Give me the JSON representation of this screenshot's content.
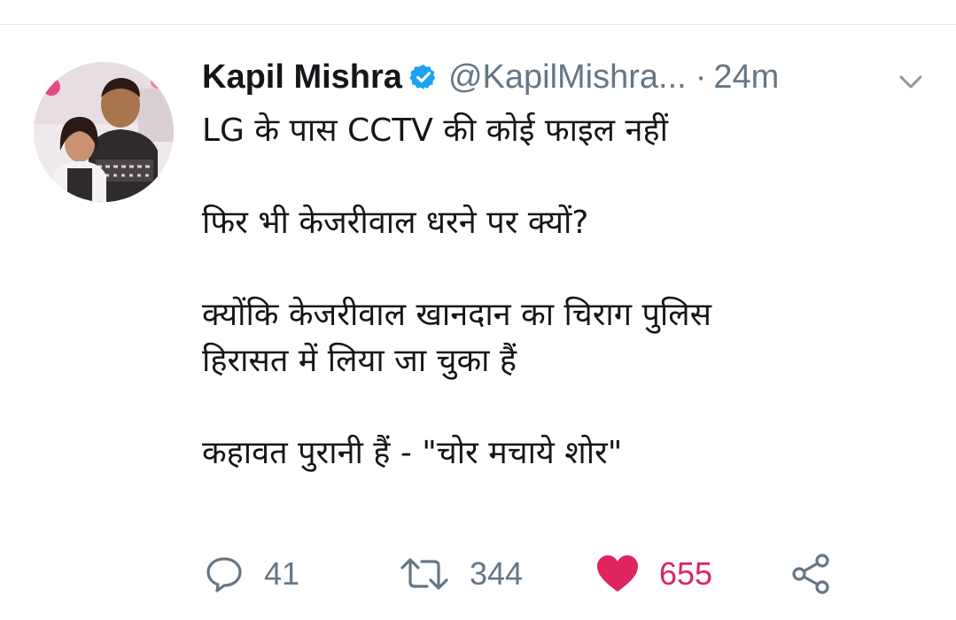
{
  "tweet": {
    "display_name": "Kapil Mishra",
    "handle": "@KapilMishra...",
    "separator": "·",
    "time": "24m",
    "body": {
      "line1": "LG के पास CCTV की कोई फाइल नहीं",
      "line2": "फिर भी केजरीवाल धरने पर क्यों?",
      "line3": "क्योंकि केजरीवाल खानदान का चिराग पुलिस",
      "line4": "हिरासत में लिया जा चुका हैं",
      "line5": "कहावत पुरानी हैं - \"चोर मचाये शोर\""
    }
  },
  "actions": {
    "reply_count": "41",
    "retweet_count": "344",
    "like_count": "655"
  },
  "icons": {
    "verified": "verified-badge-icon",
    "caret": "chevron-down-icon",
    "reply": "reply-icon",
    "retweet": "retweet-icon",
    "like": "heart-icon",
    "share": "share-icon"
  },
  "colors": {
    "verified": "#1da1f2",
    "like": "#e0245e",
    "muted": "#657786"
  }
}
